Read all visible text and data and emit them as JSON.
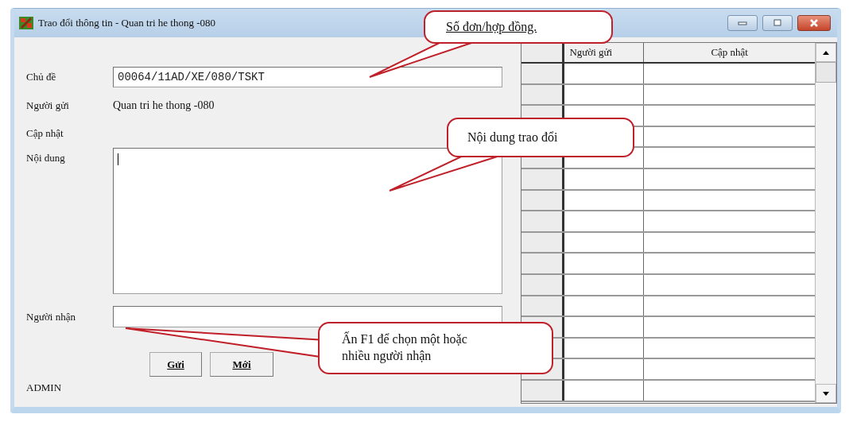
{
  "window": {
    "title": "Trao đổi thông tin - Quan tri he thong -080"
  },
  "form": {
    "subject_label": "Chủ đề",
    "subject_value": "00064/11AD/XE/080/TSKT",
    "sender_label": "Người gửi",
    "sender_value": "Quan tri he thong -080",
    "updated_label": "Cập nhật",
    "content_label": "Nội dung",
    "recipient_label": "Người nhận"
  },
  "buttons": [
    {
      "label": "Gửi"
    },
    {
      "label": "Mới"
    }
  ],
  "status_bar": {
    "user": "ADMIN"
  },
  "table": {
    "columns": [
      "Người gửi",
      "Cập nhật"
    ]
  },
  "callouts": [
    {
      "text": "Số đơn/hợp đồng."
    },
    {
      "text": "Nội dung trao đổi"
    },
    {
      "text": "Ấn F1 để chọn một hoặc nhiều người nhận"
    }
  ]
}
